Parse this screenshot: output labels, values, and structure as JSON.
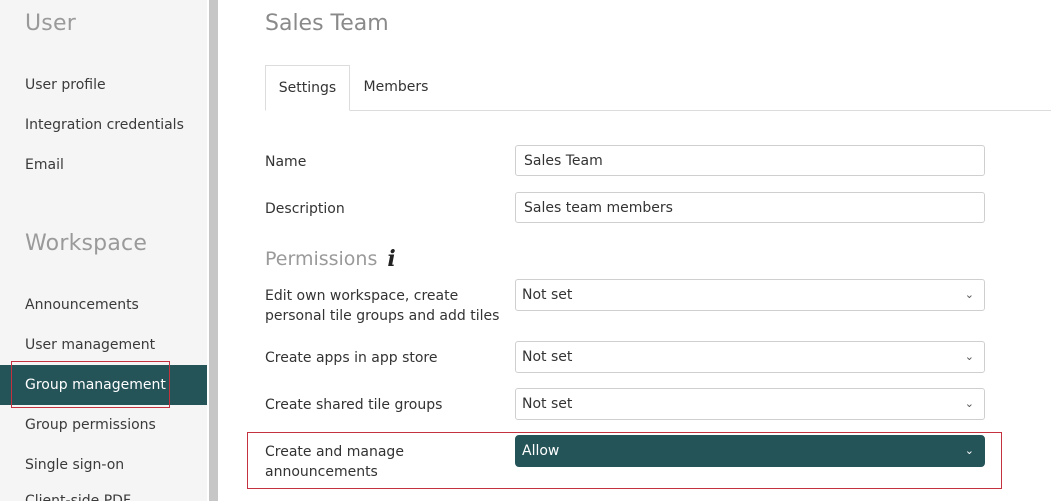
{
  "sidebar": {
    "user_heading": "User",
    "user_items": [
      "User profile",
      "Integration credentials",
      "Email"
    ],
    "workspace_heading": "Workspace",
    "workspace_items": [
      "Announcements",
      "User management",
      "Group management",
      "Group permissions",
      "Single sign-on",
      "Client-side PDF"
    ],
    "active_item": "Group management"
  },
  "page": {
    "title": "Sales Team",
    "tabs": [
      "Settings",
      "Members"
    ],
    "active_tab": "Settings"
  },
  "form": {
    "name_label": "Name",
    "name_value": "Sales Team",
    "description_label": "Description",
    "description_value": "Sales team members"
  },
  "permissions": {
    "heading": "Permissions",
    "info_glyph": "i",
    "rows": [
      {
        "label": "Edit own workspace, create personal tile groups and add tiles",
        "value": "Not set"
      },
      {
        "label": "Create apps in app store",
        "value": "Not set"
      },
      {
        "label": "Create shared tile groups",
        "value": "Not set"
      },
      {
        "label": "Create and manage announcements",
        "value": "Allow"
      }
    ]
  },
  "colors": {
    "accent": "#245358",
    "highlight": "#c4313f"
  }
}
